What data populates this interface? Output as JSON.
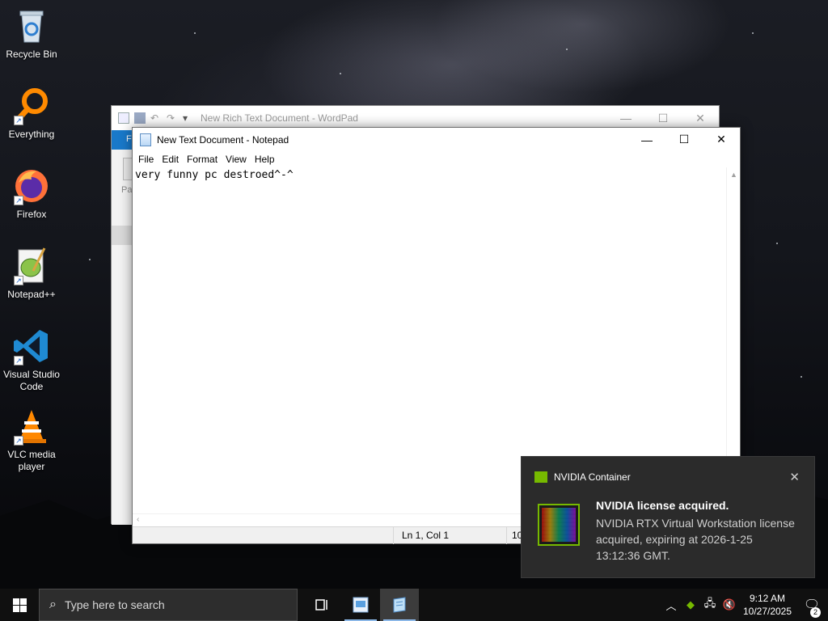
{
  "desktop": {
    "icons": [
      {
        "label": "Recycle Bin"
      },
      {
        "label": "Everything"
      },
      {
        "label": "Firefox"
      },
      {
        "label": "Notepad++"
      },
      {
        "label": "Visual Studio Code"
      },
      {
        "label": "VLC media player"
      }
    ]
  },
  "wordpad": {
    "title": "New Rich Text Document - WordPad",
    "ribbon_tab": "F",
    "side_label": "Pa"
  },
  "notepad": {
    "title": "New Text Document - Notepad",
    "menu": [
      "File",
      "Edit",
      "Format",
      "View",
      "Help"
    ],
    "content": "very funny pc destroed^-^",
    "status_position": "Ln 1, Col 1",
    "status_zoom": "10"
  },
  "toast": {
    "app_name": "NVIDIA Container",
    "title": "NVIDIA license acquired.",
    "body": "NVIDIA RTX Virtual Workstation license acquired, expiring at 2026-1-25 13:12:36 GMT.",
    "accent": "#76b900"
  },
  "taskbar": {
    "search_placeholder": "Type here to search",
    "clock_time": "9:12 AM",
    "clock_date": "10/27/2025",
    "notification_count": "2"
  }
}
